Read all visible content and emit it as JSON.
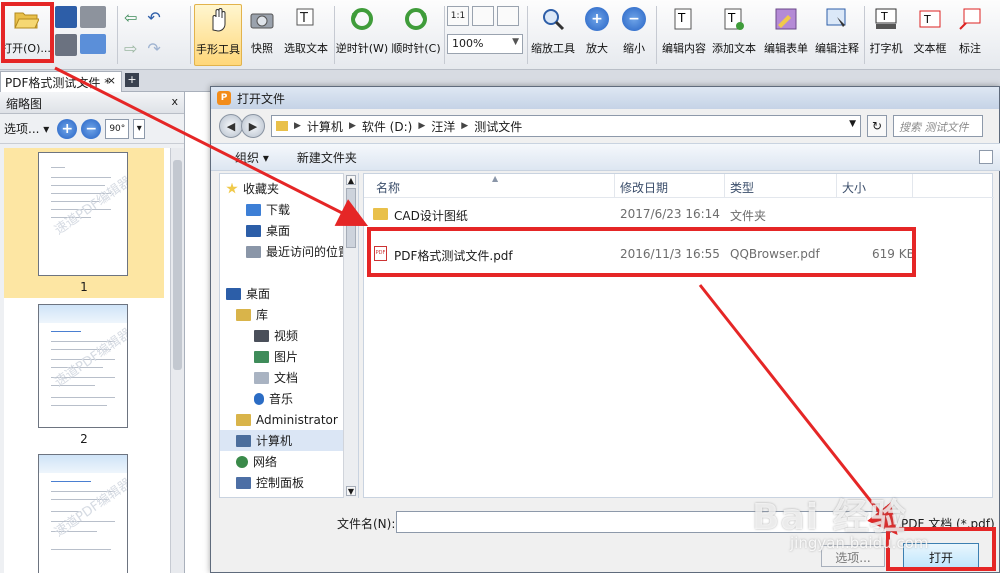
{
  "toolbar": {
    "buttons": [
      {
        "label": "打开(O)...",
        "icon": "folder-open-icon"
      },
      {
        "label": "手形工具",
        "icon": "hand-icon"
      },
      {
        "label": "快照",
        "icon": "camera-icon"
      },
      {
        "label": "选取文本",
        "icon": "select-text-icon"
      },
      {
        "label": "逆时针(W)",
        "icon": "rotate-ccw-icon"
      },
      {
        "label": "顺时针(C)",
        "icon": "rotate-cw-icon"
      },
      {
        "label": "缩放工具",
        "icon": "zoom-tool-icon"
      },
      {
        "label": "放大",
        "icon": "zoom-in-icon"
      },
      {
        "label": "缩小",
        "icon": "zoom-out-icon"
      },
      {
        "label": "编辑内容",
        "icon": "edit-content-icon"
      },
      {
        "label": "添加文本",
        "icon": "add-text-icon"
      },
      {
        "label": "编辑表单",
        "icon": "edit-form-icon"
      },
      {
        "label": "编辑注释",
        "icon": "edit-annotation-icon"
      },
      {
        "label": "打字机",
        "icon": "typewriter-icon"
      },
      {
        "label": "文本框",
        "icon": "textbox-icon"
      },
      {
        "label": "标注",
        "icon": "callout-icon"
      }
    ],
    "zoom_value": "100%",
    "zoom_preset_labels": [
      "1:1",
      "",
      ""
    ]
  },
  "tabs": {
    "document_tab": "PDF格式测试文件 *",
    "close_symbol": "×",
    "new_tab_symbol": "+"
  },
  "thumbnail_panel": {
    "title": "缩略图",
    "close_symbol": "x",
    "options_label": "选项...",
    "rotate_label": "90°",
    "watermark": "速道PDF编辑器",
    "pages": [
      {
        "number": "1",
        "selected": true
      },
      {
        "number": "2",
        "selected": false
      }
    ]
  },
  "dialog": {
    "title": "打开文件",
    "title_icon": "P",
    "breadcrumb": [
      "计算机",
      "软件 (D:)",
      "汪洋",
      "测试文件"
    ],
    "search_placeholder": "搜索 测试文件",
    "commands": {
      "organize": "组织 ▾",
      "new_folder": "新建文件夹"
    },
    "nav_items": [
      {
        "label": "收藏夹",
        "icon": "star-icon",
        "color": "#f0c94a"
      },
      {
        "label": "下载",
        "icon": "download-folder-icon",
        "color": "#3d7fd6"
      },
      {
        "label": "桌面",
        "icon": "desktop-icon",
        "color": "#2c5ea8"
      },
      {
        "label": "最近访问的位置",
        "icon": "recent-icon",
        "color": "#8a96a8"
      },
      {
        "label": "桌面",
        "icon": "desktop-icon",
        "color": "#2c5ea8"
      },
      {
        "label": "库",
        "icon": "library-icon",
        "color": "#d9b44a"
      },
      {
        "label": "视频",
        "icon": "video-icon",
        "color": "#4a4f5a"
      },
      {
        "label": "图片",
        "icon": "picture-icon",
        "color": "#3f8c5a"
      },
      {
        "label": "文档",
        "icon": "document-icon",
        "color": "#a9b3c2"
      },
      {
        "label": "音乐",
        "icon": "music-icon",
        "color": "#2b6cc4"
      },
      {
        "label": "Administrator",
        "icon": "user-folder-icon",
        "color": "#d9b44a"
      },
      {
        "label": "计算机",
        "icon": "computer-icon",
        "color": "#4c6e9c"
      },
      {
        "label": "网络",
        "icon": "network-icon",
        "color": "#3a8a4a"
      },
      {
        "label": "控制面板",
        "icon": "control-panel-icon",
        "color": "#4d6fa5"
      }
    ],
    "columns": {
      "name": "名称",
      "modified": "修改日期",
      "type": "类型",
      "size": "大小"
    },
    "files": [
      {
        "name": "CAD设计图纸",
        "modified": "2017/6/23 16:14",
        "type": "文件夹",
        "size": "",
        "kind": "folder"
      },
      {
        "name": "PDF格式测试文件.pdf",
        "modified": "2016/11/3 16:55",
        "type": "QQBrowser.pdf",
        "size": "619 KB",
        "kind": "pdf"
      }
    ],
    "filename_label": "文件名(N):",
    "filename_value": "",
    "filetype_label": "PDF 文档 (*.pdf)",
    "tools_label": "选项...",
    "open_button": "打开"
  },
  "annotation_color": "#e52626",
  "watermark": {
    "brand": "Bai 经验",
    "domain": "jingyan.baidu.com"
  }
}
